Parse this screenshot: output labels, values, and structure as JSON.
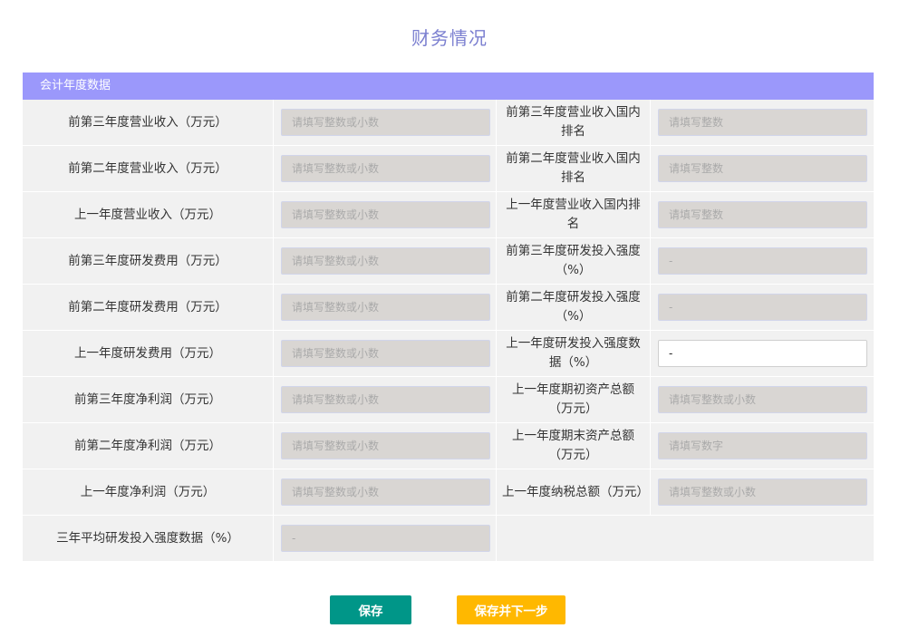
{
  "page": {
    "title": "财务情况"
  },
  "section": {
    "header": "会计年度数据"
  },
  "rows": [
    {
      "left_label": "前第三年度营业收入（万元）",
      "left_placeholder": "请填写整数或小数",
      "right_label": "前第三年度营业收入国内排名",
      "right_placeholder": "请填写整数"
    },
    {
      "left_label": "前第二年度营业收入（万元）",
      "left_placeholder": "请填写整数或小数",
      "right_label": "前第二年度营业收入国内排名",
      "right_placeholder": "请填写整数"
    },
    {
      "left_label": "上一年度营业收入（万元）",
      "left_placeholder": "请填写整数或小数",
      "right_label": "上一年度营业收入国内排名",
      "right_placeholder": "请填写整数"
    },
    {
      "left_label": "前第三年度研发费用（万元）",
      "left_placeholder": "请填写整数或小数",
      "right_label": "前第三年度研发投入强度（%）",
      "right_value": "-"
    },
    {
      "left_label": "前第二年度研发费用（万元）",
      "left_placeholder": "请填写整数或小数",
      "right_label": "前第二年度研发投入强度（%）",
      "right_value": "-"
    },
    {
      "left_label": "上一年度研发费用（万元）",
      "left_placeholder": "请填写整数或小数",
      "right_label": "上一年度研发投入强度数据（%）",
      "right_value": "-"
    },
    {
      "left_label": "前第三年度净利润（万元）",
      "left_placeholder": "请填写整数或小数",
      "right_label": "上一年度期初资产总额（万元）",
      "right_placeholder": "请填写整数或小数"
    },
    {
      "left_label": "前第二年度净利润（万元）",
      "left_placeholder": "请填写整数或小数",
      "right_label": "上一年度期末资产总额（万元）",
      "right_placeholder": "请填写数字"
    },
    {
      "left_label": "上一年度净利润（万元）",
      "left_placeholder": "请填写整数或小数",
      "right_label": "上一年度纳税总额（万元）",
      "right_placeholder": "请填写整数或小数"
    },
    {
      "left_label": "三年平均研发投入强度数据（%）",
      "left_value": "-"
    }
  ],
  "buttons": {
    "save": "保存",
    "save_next": "保存并下一步"
  },
  "colors": {
    "title": "#7b7fd0",
    "header_bg": "#9b98fb",
    "save_button": "#009688",
    "save_next_button": "#ffb800"
  }
}
